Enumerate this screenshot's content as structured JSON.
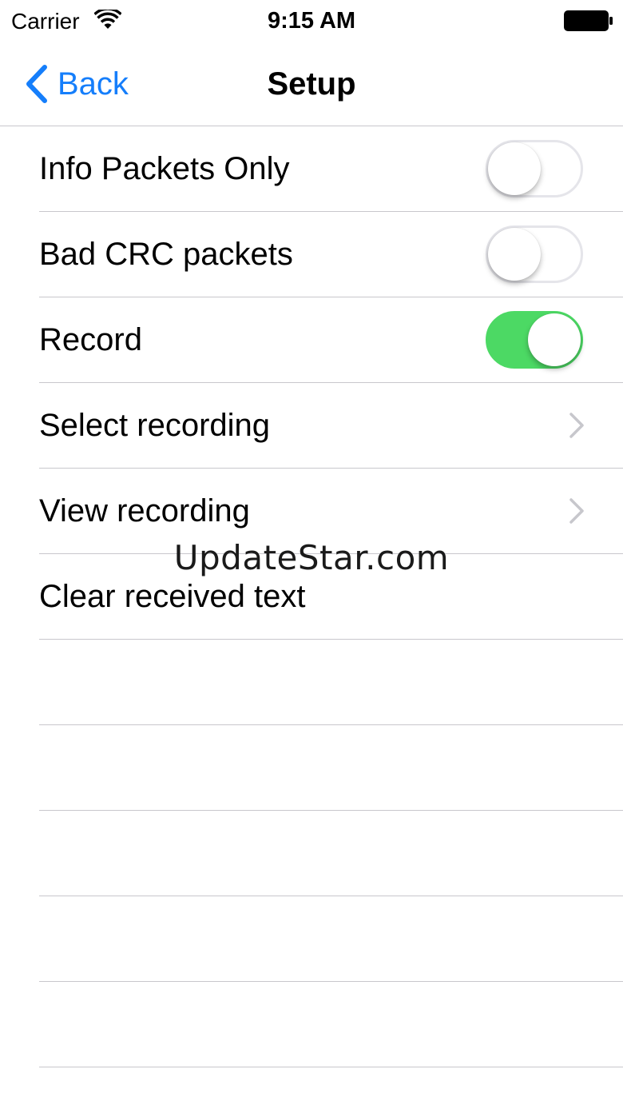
{
  "status_bar": {
    "carrier": "Carrier",
    "time": "9:15 AM"
  },
  "nav": {
    "back_label": "Back",
    "title": "Setup"
  },
  "rows": [
    {
      "label": "Info Packets Only",
      "accessory": "switch",
      "on": false
    },
    {
      "label": "Bad CRC packets",
      "accessory": "switch",
      "on": false
    },
    {
      "label": "Record",
      "accessory": "switch",
      "on": true
    },
    {
      "label": "Select recording",
      "accessory": "chevron"
    },
    {
      "label": "View recording",
      "accessory": "chevron"
    },
    {
      "label": "Clear received text",
      "accessory": "none"
    },
    {
      "label": "",
      "accessory": "none"
    },
    {
      "label": "",
      "accessory": "none"
    },
    {
      "label": "",
      "accessory": "none"
    },
    {
      "label": "",
      "accessory": "none"
    },
    {
      "label": "",
      "accessory": "none"
    }
  ],
  "watermark": "UpdateStar.com",
  "colors": {
    "accent": "#157efb",
    "switch_on": "#4cd964",
    "separator": "#c8c7cc"
  },
  "icons": {
    "wifi": "wifi-icon",
    "battery": "battery-icon",
    "back": "chevron-left-icon",
    "disclosure": "chevron-right-icon"
  }
}
